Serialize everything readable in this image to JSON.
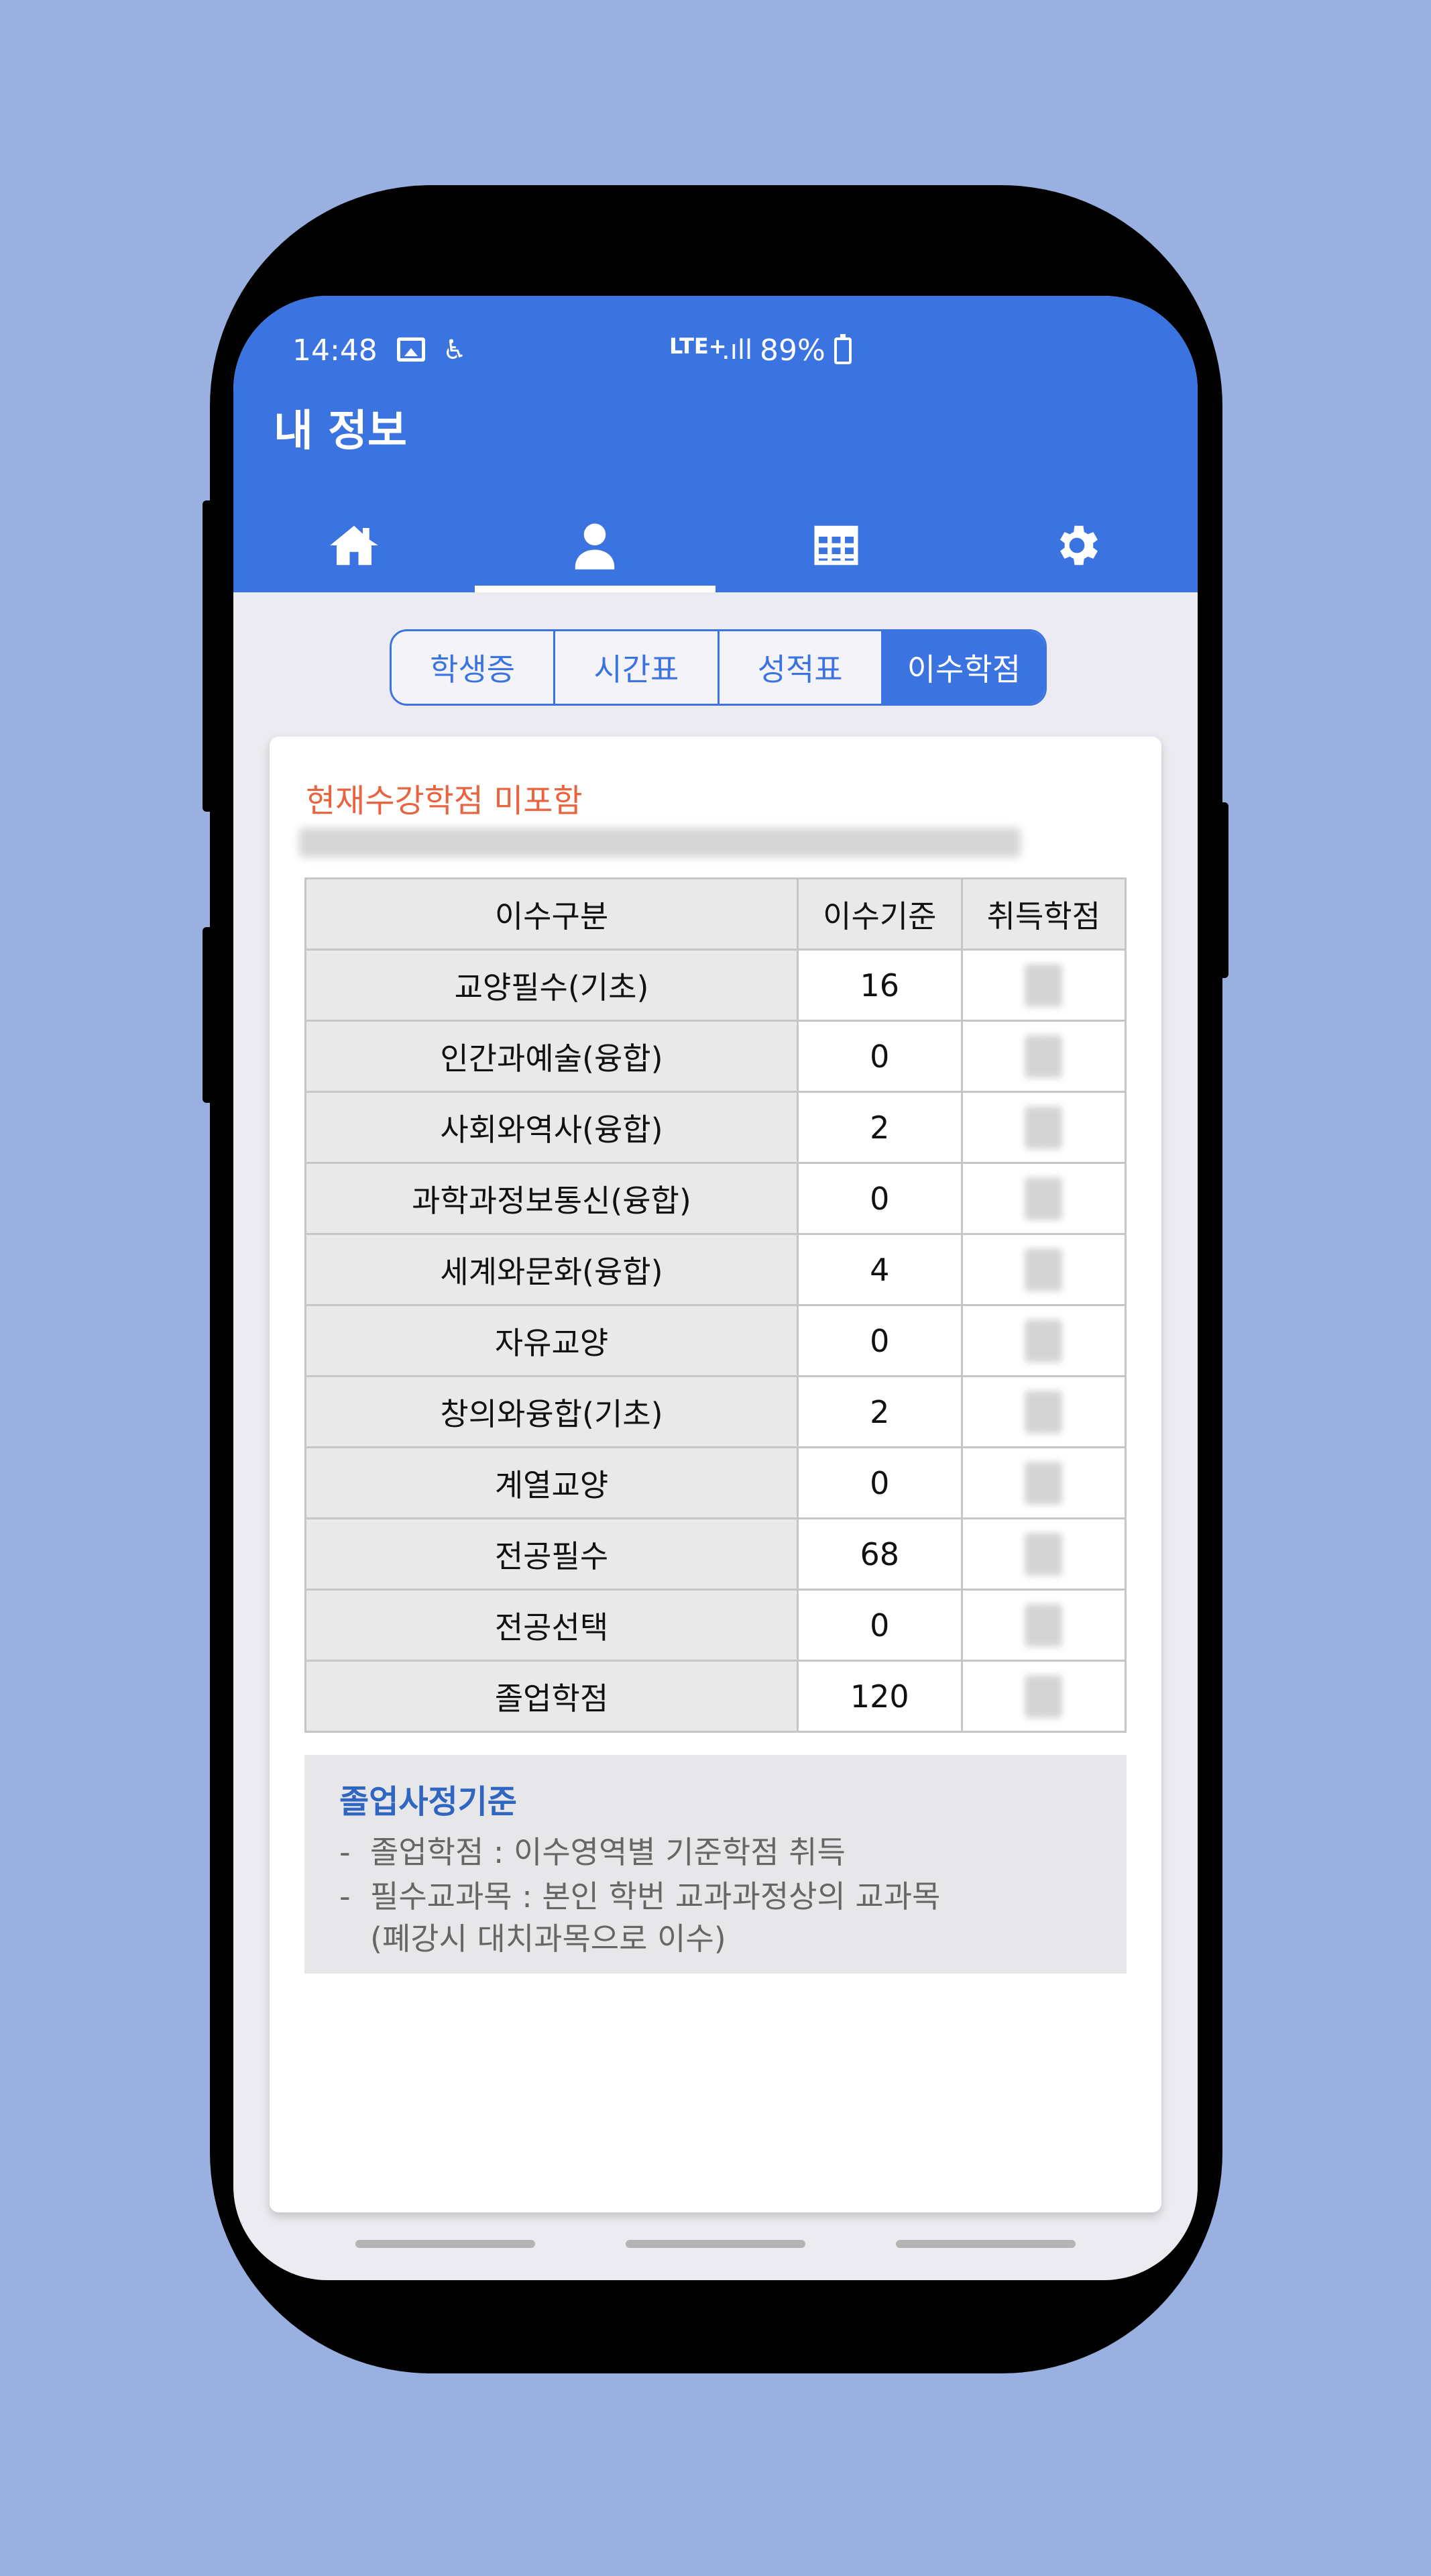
{
  "status_bar": {
    "time": "14:48",
    "network": "LTE+",
    "signal": ".ıll",
    "battery": "89%",
    "icons": [
      "image-icon",
      "accessibility-icon",
      "signal-icon",
      "battery-charging-icon"
    ]
  },
  "app_bar": {
    "title": "내 정보",
    "tabs": [
      {
        "icon": "home-icon",
        "active": false
      },
      {
        "icon": "person-icon",
        "active": true
      },
      {
        "icon": "table-icon",
        "active": false
      },
      {
        "icon": "gear-icon",
        "active": false
      }
    ],
    "accent_color": "#3b74e0"
  },
  "segment": {
    "items": [
      "학생증",
      "시간표",
      "성적표",
      "이수학점"
    ],
    "selected": "이수학점"
  },
  "card": {
    "notice": "현재수강학점 미포함",
    "table": {
      "headers": [
        "이수구분",
        "이수기준",
        "취득학점"
      ],
      "rows": [
        {
          "category": "교양필수(기초)",
          "required": "16"
        },
        {
          "category": "인간과예술(융합)",
          "required": "0"
        },
        {
          "category": "사회와역사(융합)",
          "required": "2"
        },
        {
          "category": "과학과정보통신(융합)",
          "required": "0"
        },
        {
          "category": "세계와문화(융합)",
          "required": "4"
        },
        {
          "category": "자유교양",
          "required": "0"
        },
        {
          "category": "창의와융합(기초)",
          "required": "2"
        },
        {
          "category": "계열교양",
          "required": "0"
        },
        {
          "category": "전공필수",
          "required": "68"
        },
        {
          "category": "전공선택",
          "required": "0"
        },
        {
          "category": "졸업학점",
          "required": "120"
        }
      ]
    },
    "info": {
      "title": "졸업사정기준",
      "line1": "졸업학점 : 이수영역별 기준학점 취득",
      "line2": "필수교과목 : 본인 학번 교과과정상의 교과목",
      "line3": "(폐강시 대치과목으로 이수)",
      "dash": "-"
    }
  }
}
